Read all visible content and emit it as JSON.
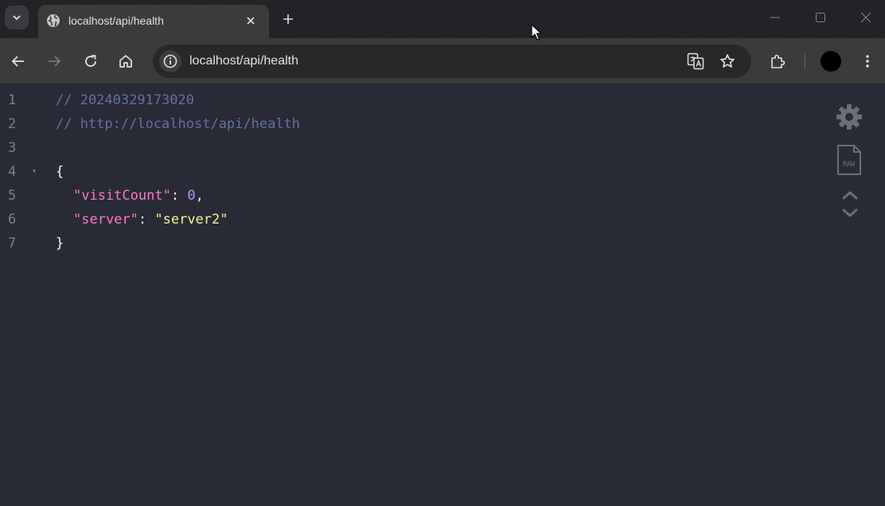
{
  "tab": {
    "title": "localhost/api/health",
    "favicon": "globe-icon"
  },
  "toolbar": {
    "url": "localhost/api/health",
    "back": "back-arrow-icon",
    "forward": "forward-arrow-icon",
    "reload": "reload-icon",
    "home": "home-icon"
  },
  "viewer": {
    "lines": [
      {
        "n": "1",
        "text": "// 20240329173020"
      },
      {
        "n": "2",
        "text": "// http://localhost/api/health"
      },
      {
        "n": "3",
        "text": ""
      },
      {
        "n": "4",
        "text": "{"
      },
      {
        "n": "5",
        "key": "\"visitCount\"",
        "sep": ": ",
        "value": "0",
        "tail": ","
      },
      {
        "n": "6",
        "key": "\"server\"",
        "sep": ": ",
        "value": "\"server2\"",
        "tail": ""
      },
      {
        "n": "7",
        "text": "}"
      }
    ],
    "fold_marker": "▾",
    "tools": [
      "gear-icon",
      "raw-file-icon",
      "collapse-icon",
      "expand-icon"
    ],
    "raw_label": "RAW"
  },
  "colors": {
    "background": "#282a36",
    "comment": "#6272a4",
    "key": "#ff79c6",
    "number": "#bd93f9",
    "string": "#f1fa8c",
    "line_number": "#6d8a88"
  }
}
